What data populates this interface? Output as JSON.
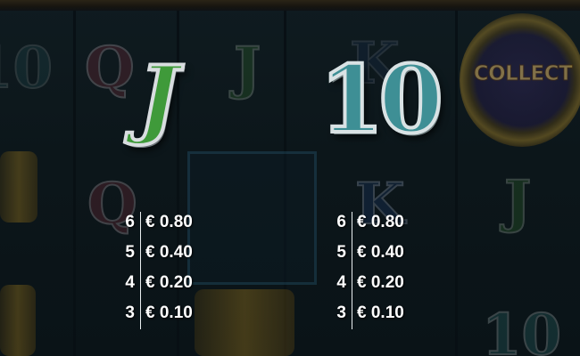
{
  "background": {
    "collect_label": "COLLECT",
    "ghost_symbols": [
      "Q",
      "J",
      "K",
      "10",
      "Q",
      "J",
      "K",
      "10"
    ]
  },
  "symbols": [
    {
      "name": "J",
      "label": "J",
      "color": "#3f9a3a",
      "payouts": [
        {
          "count": "6",
          "value": "€ 0.80"
        },
        {
          "count": "5",
          "value": "€ 0.40"
        },
        {
          "count": "4",
          "value": "€ 0.20"
        },
        {
          "count": "3",
          "value": "€ 0.10"
        }
      ]
    },
    {
      "name": "10",
      "label": "10",
      "color": "#3e8f95",
      "payouts": [
        {
          "count": "6",
          "value": "€ 0.80"
        },
        {
          "count": "5",
          "value": "€ 0.40"
        },
        {
          "count": "4",
          "value": "€ 0.20"
        },
        {
          "count": "3",
          "value": "€ 0.10"
        }
      ]
    }
  ]
}
